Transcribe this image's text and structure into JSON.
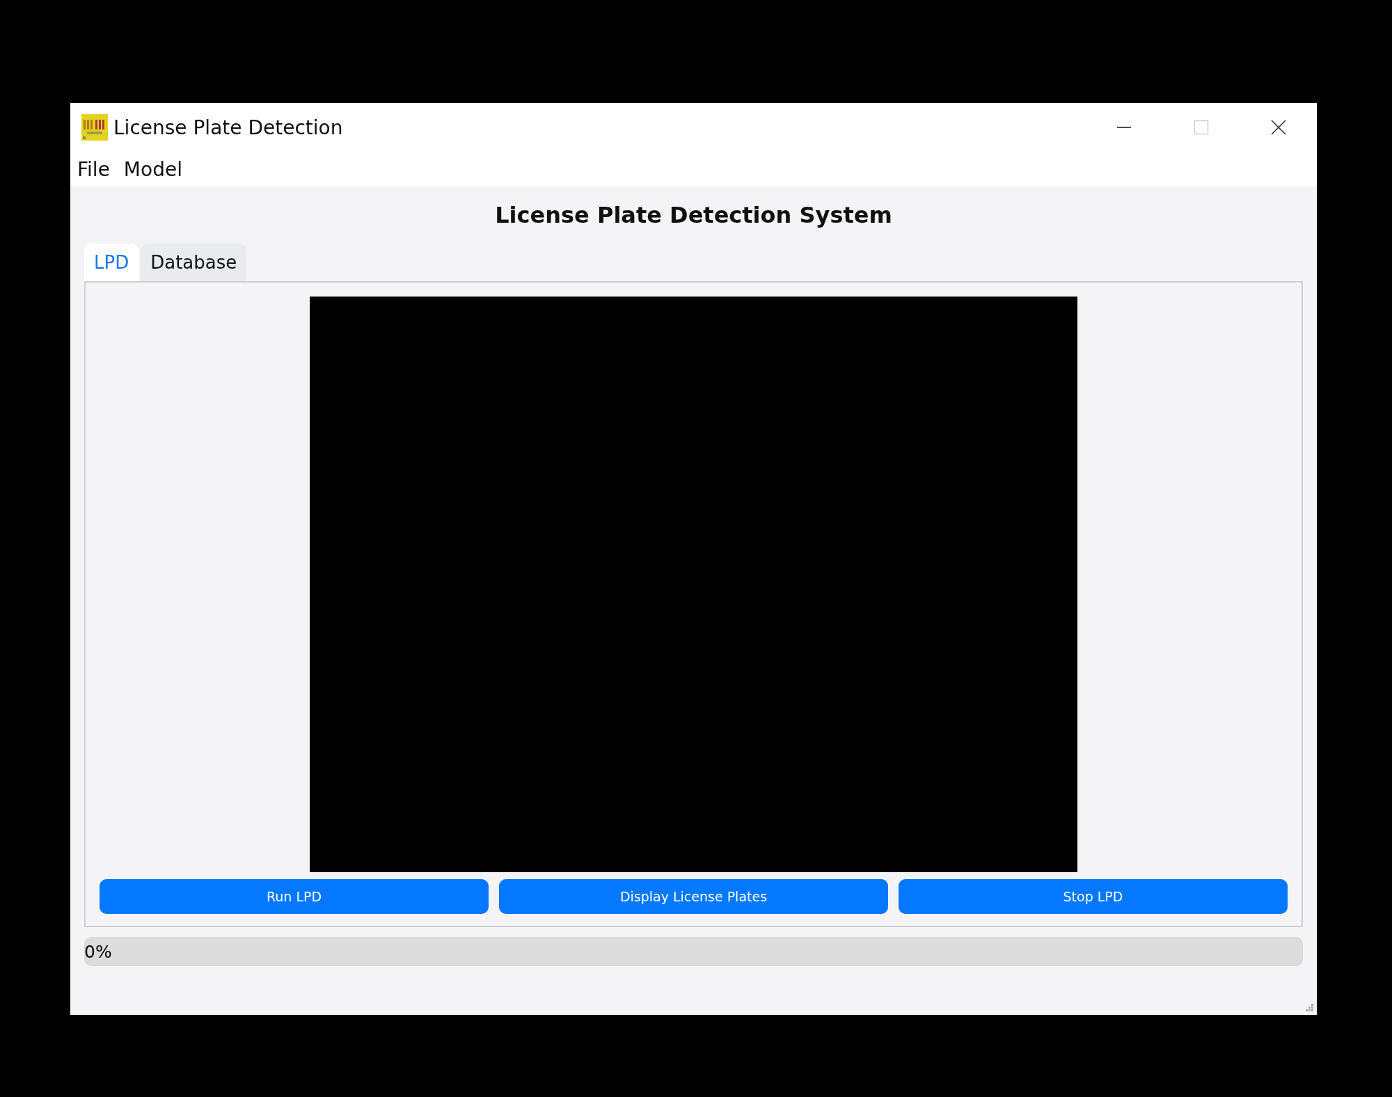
{
  "window": {
    "title": "License Plate Detection"
  },
  "menu": [
    "File",
    "Model"
  ],
  "heading": "License Plate Detection System",
  "tabs": [
    {
      "label": "LPD",
      "selected": true
    },
    {
      "label": "Database",
      "selected": false
    }
  ],
  "buttons": [
    "Run LPD",
    "Display License Plates",
    "Stop LPD"
  ],
  "progress": {
    "level": 0,
    "text": "0%"
  }
}
